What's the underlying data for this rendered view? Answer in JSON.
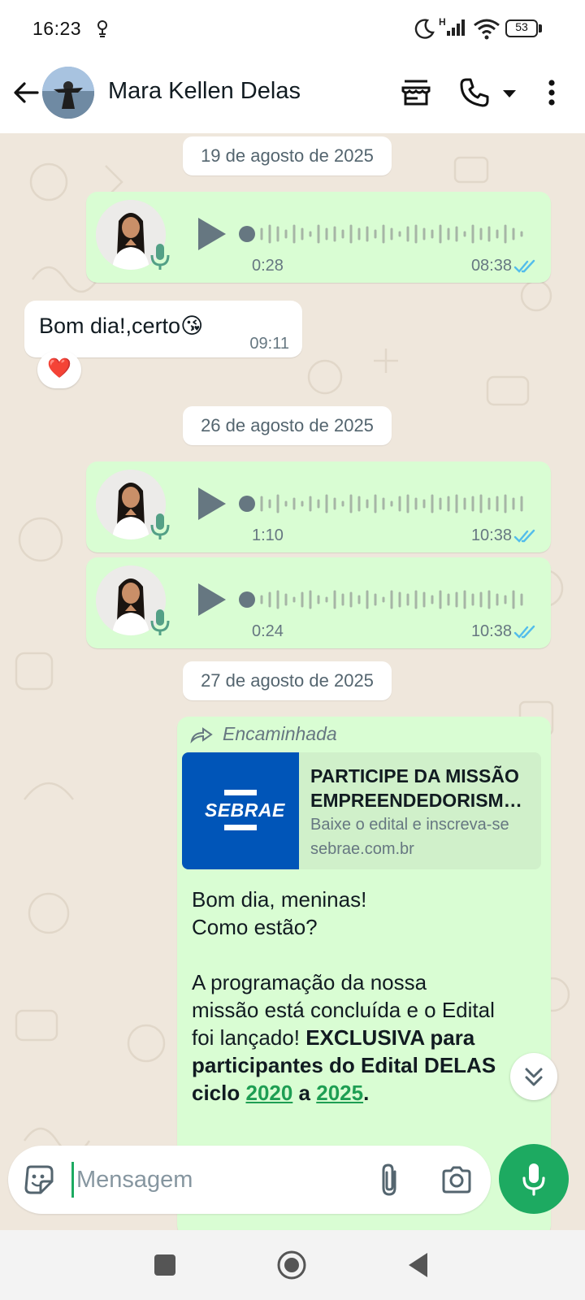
{
  "status_bar": {
    "time": "16:23",
    "network_label": "H",
    "battery_level": "53"
  },
  "header": {
    "contact_name": "Mara Kellen Delas"
  },
  "chat": {
    "messages": [
      {
        "type": "date",
        "text": "19 de agosto de 2025"
      },
      {
        "type": "voice",
        "direction": "outgoing",
        "duration": "0:28",
        "time": "08:38",
        "status": "read"
      },
      {
        "type": "text",
        "direction": "incoming",
        "text": "Bom dia!,certo😘",
        "time": "09:11",
        "reaction": "❤️"
      },
      {
        "type": "date",
        "text": "26 de agosto de 2025"
      },
      {
        "type": "voice",
        "direction": "outgoing",
        "duration": "1:10",
        "time": "10:38",
        "status": "read"
      },
      {
        "type": "voice",
        "direction": "outgoing",
        "duration": "0:24",
        "time": "10:38",
        "status": "read"
      },
      {
        "type": "date",
        "text": "27 de agosto de 2025"
      },
      {
        "type": "forwarded_link",
        "direction": "outgoing",
        "forwarded_label": "Encaminhada",
        "link": {
          "brand": "SEBRAE",
          "title_line1": "PARTICIPE DA MISSÃO",
          "title_line2": "EMPREENDEDORISMO FEMININO",
          "description": "Baixe o edital e inscreva-se",
          "domain": "sebrae.com.br"
        },
        "body": {
          "line1": "Bom dia, meninas!",
          "line2": "Como estão?",
          "para_line1": "A programação da nossa",
          "para_line2": "missão está concluída e o Edital",
          "para_line3_plain": "foi lançado! ",
          "para_line3_bold": "EXCLUSIVA para",
          "bold_line4": "participantes do Edital DELAS",
          "bold_line5_a": "ciclo ",
          "link_2020": "2020",
          "bold_line5_b": " a ",
          "link_2025": "2025",
          "bold_line5_c": "."
        }
      }
    ]
  },
  "composer": {
    "placeholder": "Mensagem"
  },
  "colors": {
    "outgoing_bubble": "#d9fdd3",
    "incoming_bubble": "#ffffff",
    "accent_green": "#1daa61",
    "read_ticks": "#53bdeb",
    "sebrae_blue": "#0055b8"
  },
  "icons": [
    "back-arrow-icon",
    "store-icon",
    "call-icon",
    "caret-down-icon",
    "more-vertical-icon",
    "play-icon",
    "mic-icon",
    "double-check-icon",
    "forward-icon",
    "scroll-down-icon",
    "sticker-icon",
    "attach-icon",
    "camera-icon",
    "alarm-icon",
    "moon-icon",
    "signal-icon",
    "wifi-icon",
    "battery-icon",
    "nav-recents-icon",
    "nav-home-icon",
    "nav-back-icon"
  ]
}
